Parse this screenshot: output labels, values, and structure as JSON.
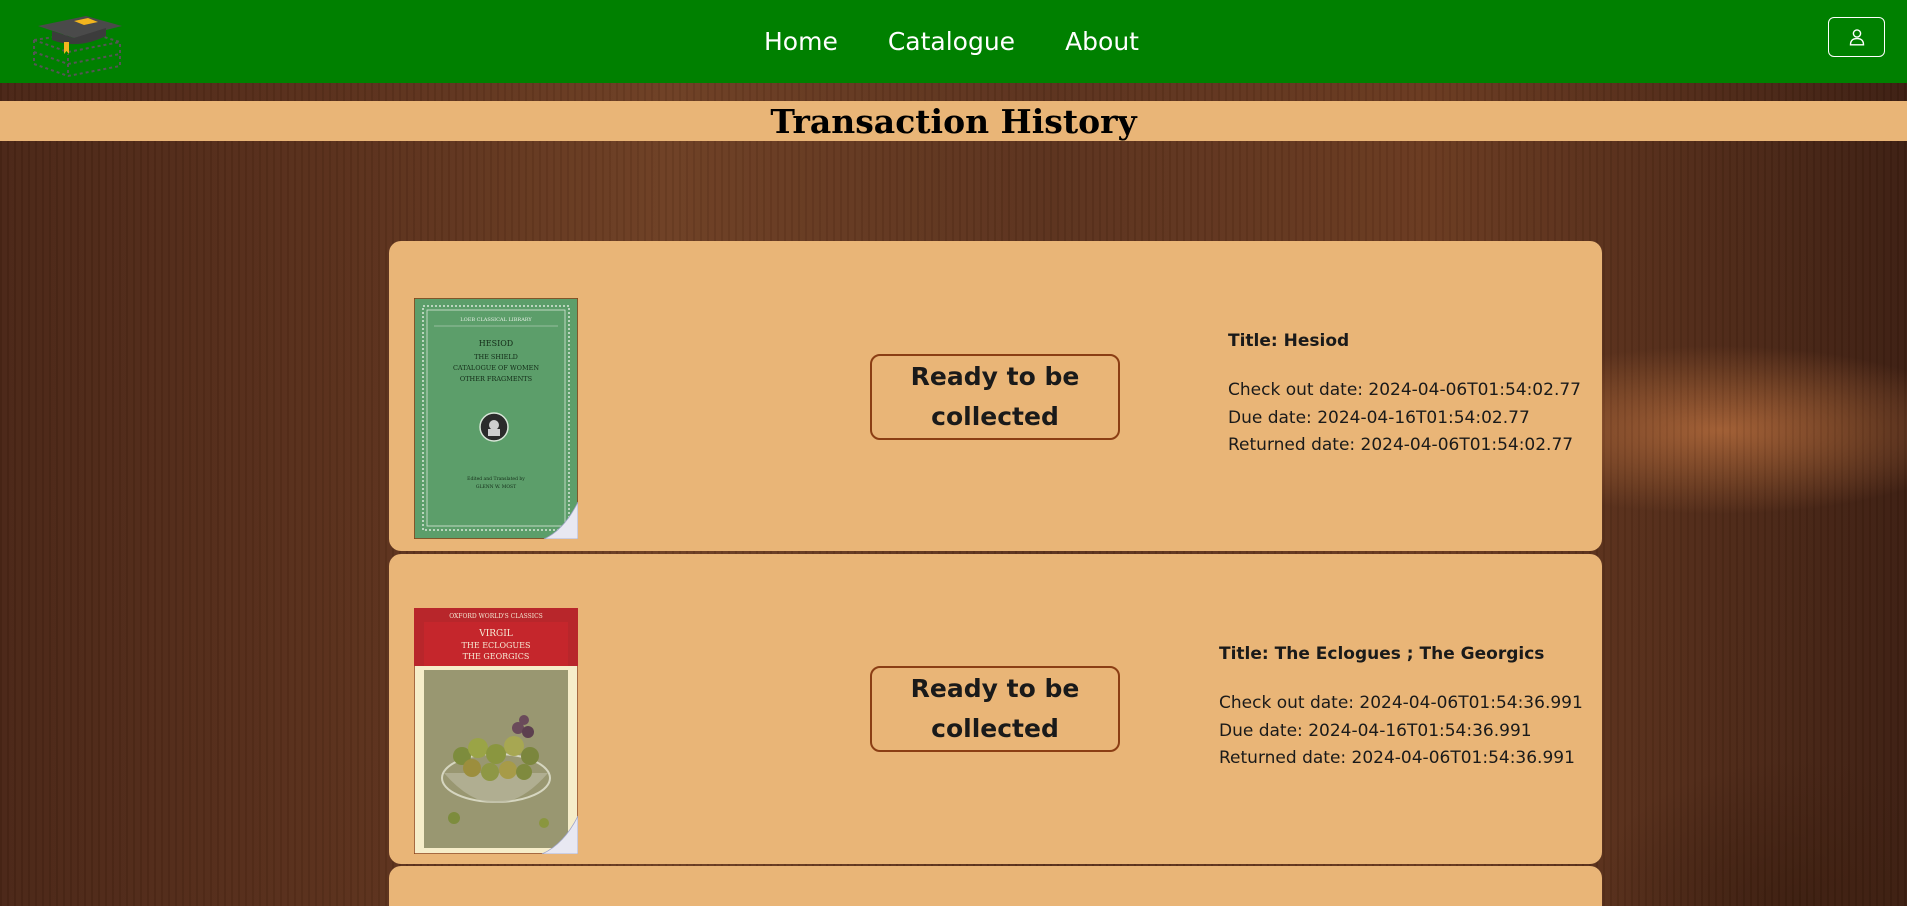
{
  "header": {
    "nav": [
      "Home",
      "Catalogue",
      "About"
    ],
    "page_title": "Transaction History"
  },
  "colors": {
    "topbar": "#008000",
    "card": "#e9b577",
    "status_border": "#8b3e14"
  },
  "icons": {
    "logo": "books-graduation-cap-icon",
    "user": "user-icon"
  },
  "transactions": [
    {
      "title": "Title: Hesiod",
      "checkout": "Check out date: 2024-04-06T01:54:02.77",
      "due": "Due date: 2024-04-16T01:54:02.77",
      "returned": "Returned date: 2024-04-06T01:54:02.77",
      "status": "Ready to be collected",
      "cover": {
        "series": "LOEB CLASSICAL LIBRARY",
        "line1": "HESIOD",
        "line2": "THE SHIELD",
        "line3": "CATALOGUE OF WOMEN",
        "line4": "OTHER FRAGMENTS",
        "credit1": "Edited and Translated by",
        "credit2": "GLENN W. MOST"
      }
    },
    {
      "title": "Title: The Eclogues ; The Georgics",
      "checkout": "Check out date: 2024-04-06T01:54:36.991",
      "due": "Due date: 2024-04-16T01:54:36.991",
      "returned": "Returned date: 2024-04-06T01:54:36.991",
      "status": "Ready to be collected",
      "cover": {
        "series": "OXFORD WORLD'S CLASSICS",
        "line1": "VIRGIL",
        "line2": "THE ECLOGUES",
        "line3": "THE GEORGICS"
      }
    }
  ]
}
